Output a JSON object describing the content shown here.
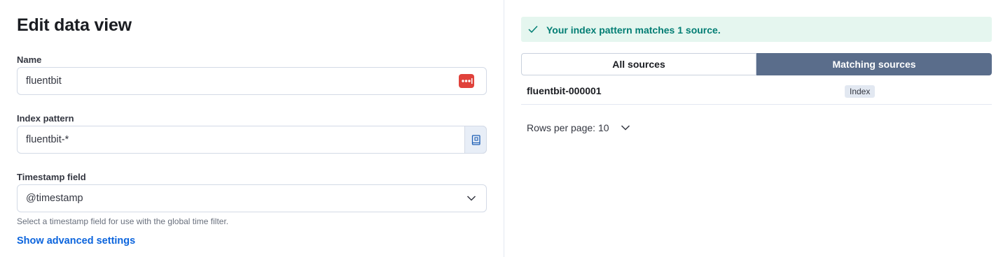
{
  "left": {
    "title": "Edit data view",
    "name": {
      "label": "Name",
      "value": "fluentbit"
    },
    "index_pattern": {
      "label": "Index pattern",
      "value": "fluentbit-*"
    },
    "timestamp": {
      "label": "Timestamp field",
      "value": "@timestamp",
      "help": "Select a timestamp field for use with the global time filter."
    },
    "advanced_link": "Show advanced settings"
  },
  "right": {
    "callout": "Your index pattern matches 1 source.",
    "tabs": [
      {
        "label": "All sources",
        "selected": false
      },
      {
        "label": "Matching sources",
        "selected": true
      }
    ],
    "rows": [
      {
        "name": "fluentbit-000001",
        "type": "Index"
      }
    ],
    "rows_per_page": "Rows per page: 10"
  },
  "colors": {
    "accent": "#0b64dd",
    "success_bg": "#e5f6ef",
    "success_text": "#017d73",
    "tab_selected": "#5a6d8b",
    "password_icon": "#e0423b"
  },
  "icons": {
    "name_field_icon": "password-manager-dots-icon",
    "index_pattern_append": "index-book-icon",
    "timestamp_select": "chevron-down-icon",
    "callout": "check-icon",
    "pager": "chevron-down-icon"
  }
}
